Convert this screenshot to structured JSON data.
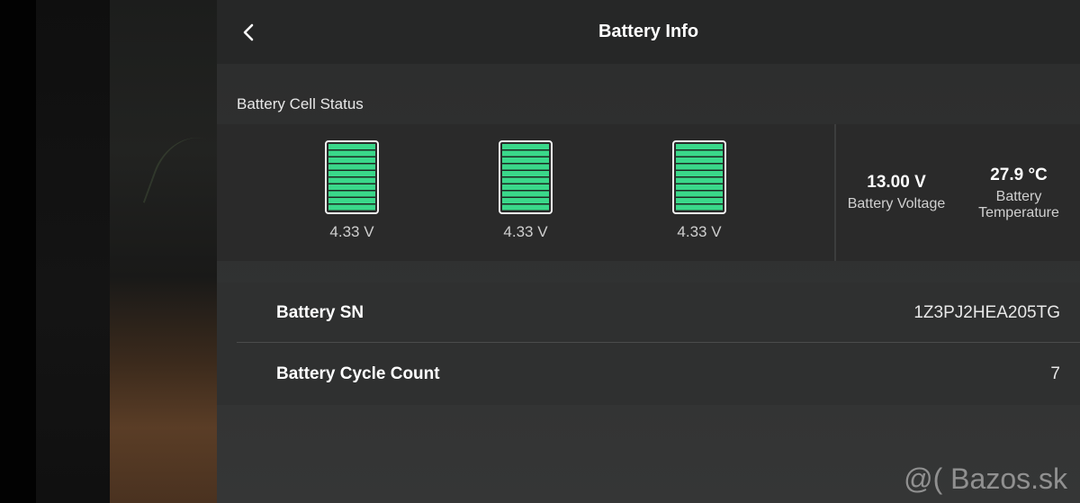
{
  "header": {
    "title": "Battery Info",
    "back_icon": "chevron-left-icon"
  },
  "cell_status": {
    "label": "Battery Cell Status",
    "cells": [
      {
        "voltage": "4.33 V",
        "level": 1.0
      },
      {
        "voltage": "4.33 V",
        "level": 1.0
      },
      {
        "voltage": "4.33 V",
        "level": 1.0
      }
    ],
    "fill_color": "#3ad88a"
  },
  "stats": {
    "voltage_value": "13.00 V",
    "voltage_label": "Battery Voltage",
    "temperature_value": "27.9 °C",
    "temperature_label_line1": "Battery",
    "temperature_label_line2": "Temperature"
  },
  "info": {
    "rows": [
      {
        "key": "Battery SN",
        "value": "1Z3PJ2HEA205TG"
      },
      {
        "key": "Battery Cycle Count",
        "value": "7"
      }
    ]
  },
  "watermark": "@( Bazos.sk"
}
